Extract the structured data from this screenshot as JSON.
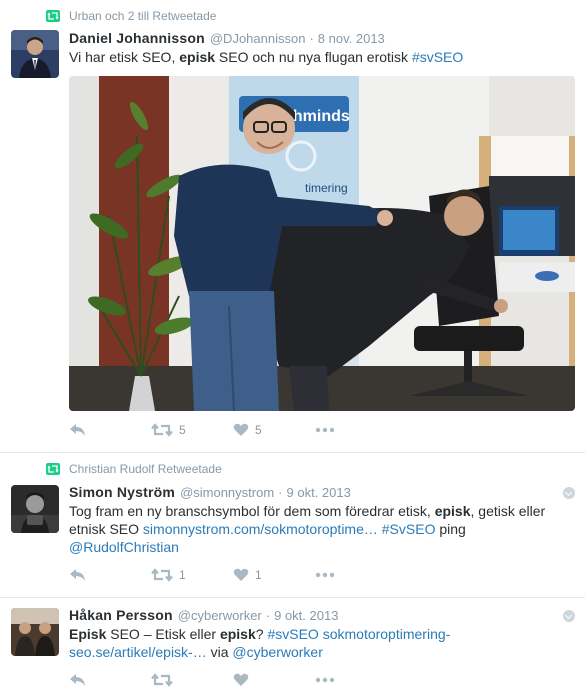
{
  "tweets": [
    {
      "retweeted_by": "Urban och 2 till Retweetade",
      "fullname": "Daniel Johannisson",
      "handle": "@DJohannisson",
      "sep": "·",
      "time": "8 nov. 2013",
      "text": {
        "p1": "Vi har etisk SEO, ",
        "b1": "episk",
        "p2": " SEO och nu nya flugan erotisk ",
        "tag1": "#svSEO"
      },
      "photo_sign": "chminds",
      "photo_sign2": "timering",
      "retweets": "5",
      "likes": "5"
    },
    {
      "retweeted_by": "Christian Rudolf Retweetade",
      "fullname": "Simon Nyström",
      "handle": "@simonnystrom",
      "sep": "·",
      "time": "9 okt. 2013",
      "text": {
        "p1": "Tog fram en ny branschsymbol för dem som föredrar etisk, ",
        "b1": "episk",
        "p2": ", getisk eller etnisk SEO ",
        "link1": "simonnystrom.com/sokmotoroptime…",
        "p3": " ",
        "tag1": "#SvSEO",
        "p4": " ping ",
        "mention1": "@RudolfChristian"
      },
      "retweets": "1",
      "likes": "1"
    },
    {
      "fullname": "Håkan Persson",
      "handle": "@cyberworker",
      "sep": "·",
      "time": "9 okt. 2013",
      "text": {
        "b0": "Episk",
        "p1": " SEO – Etisk eller ",
        "b1": "episk",
        "p2": "? ",
        "tag1": "#svSEO",
        "p3": " ",
        "link1": "sokmotoroptimering-seo.se/artikel/episk-…",
        "p4": " via ",
        "mention1": "@cyberworker"
      }
    }
  ],
  "colors": {
    "retweet_green": "#19cf86",
    "link_blue": "#2b7bb9",
    "muted": "#8899a6",
    "icon_grey": "#aab8c2"
  }
}
